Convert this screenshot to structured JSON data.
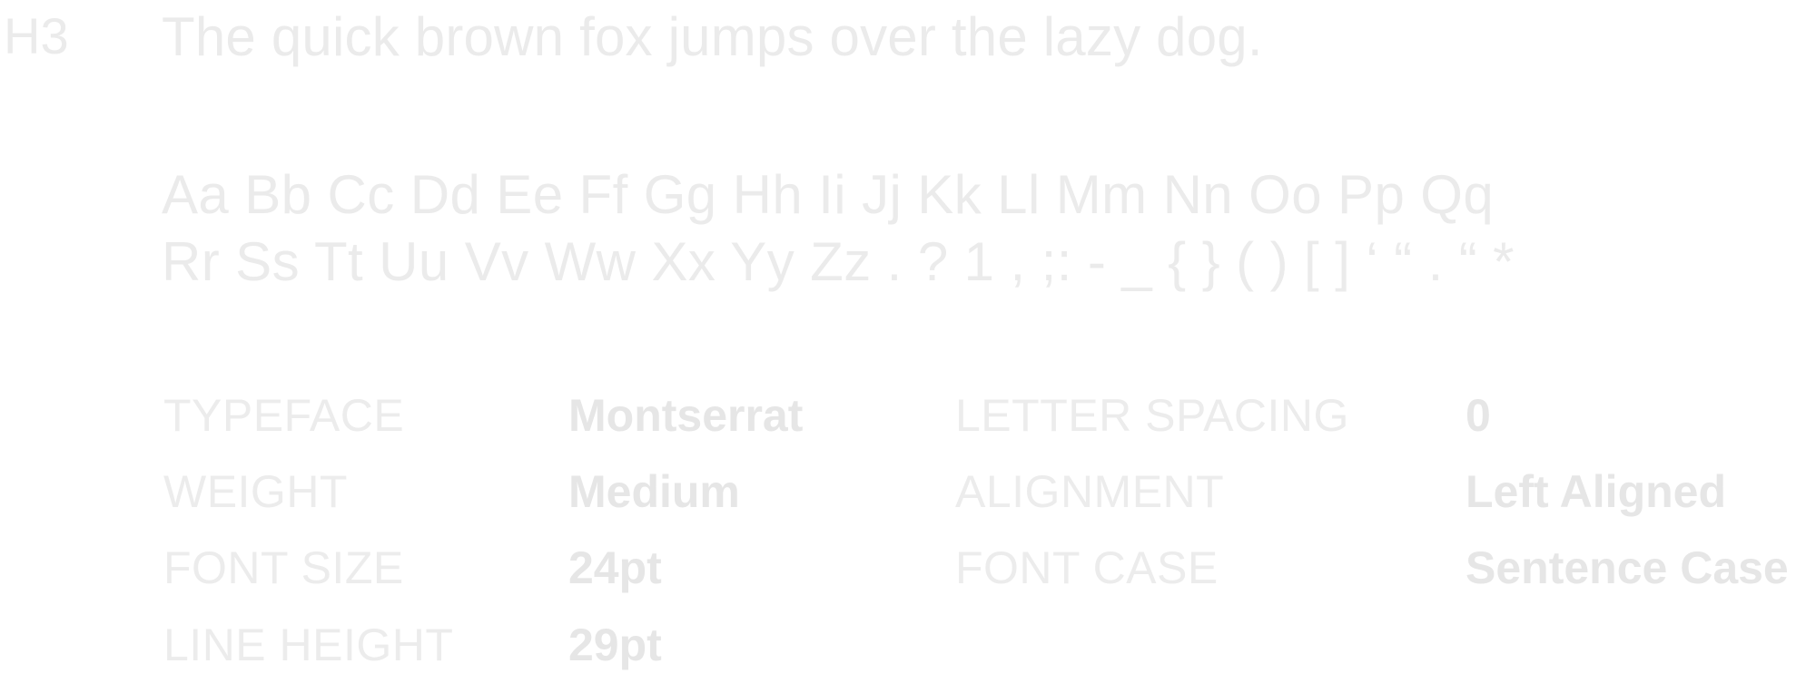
{
  "heading": {
    "tag": "H3",
    "sample_sentence": "The quick brown fox jumps over the lazy dog."
  },
  "glyph_set": {
    "lines": [
      "Aa Bb Cc Dd Ee Ff Gg Hh Ii Jj Kk Ll Mm Nn Oo Pp Qq",
      "Rr Ss Tt Uu Vv Ww Xx Yy Zz . ? 1 , ;: - _ { } ( ) [ ] ‘ “ . “ *"
    ]
  },
  "specs": {
    "typeface": {
      "label": "TYPEFACE",
      "value": "Montserrat"
    },
    "weight": {
      "label": "WEIGHT",
      "value": "Medium"
    },
    "font_size": {
      "label": "FONT SIZE",
      "value": "24pt"
    },
    "line_height": {
      "label": "LINE HEIGHT",
      "value": "29pt"
    },
    "letter_spacing": {
      "label": "LETTER SPACING",
      "value": "0"
    },
    "alignment": {
      "label": "ALIGNMENT",
      "value": "Left Aligned"
    },
    "font_case": {
      "label": "FONT CASE",
      "value": "Sentence Case"
    }
  },
  "colors": {
    "text": "#ebebeb",
    "background": "#ffffff"
  }
}
